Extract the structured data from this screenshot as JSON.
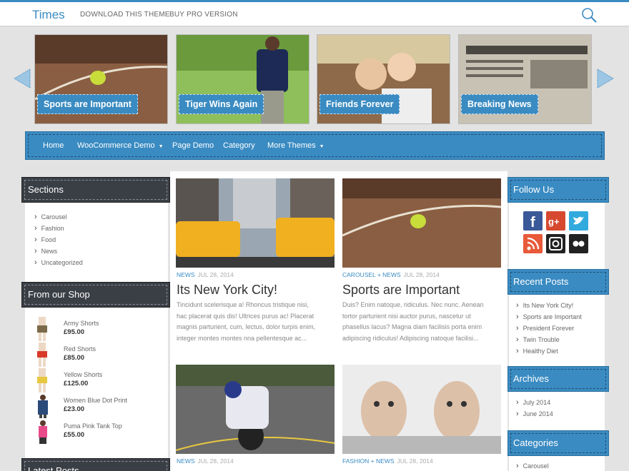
{
  "header": {
    "site_title": "Times",
    "links": [
      "DOWNLOAD THIS THEME",
      "BUY PRO VERSION"
    ]
  },
  "carousel": {
    "slides": [
      {
        "caption": "Sports are Important"
      },
      {
        "caption": "Tiger Wins Again"
      },
      {
        "caption": "Friends Forever"
      },
      {
        "caption": "Breaking News"
      }
    ]
  },
  "nav": {
    "items": [
      "Home",
      "WooCommerce Demo",
      "Page Demo",
      "Category",
      "More Themes"
    ]
  },
  "sections": {
    "title": "Sections",
    "items": [
      "Carousel",
      "Fashion",
      "Food",
      "News",
      "Uncategorized"
    ]
  },
  "shop": {
    "title": "From our Shop",
    "items": [
      {
        "name": "Army Shorts",
        "price": "£95.00"
      },
      {
        "name": "Red Shorts",
        "price": "£85.00"
      },
      {
        "name": "Yellow Shorts",
        "price": "£125.00"
      },
      {
        "name": "Women Blue Dot Print",
        "price": "£23.00"
      },
      {
        "name": "Puma Pink Tank Top",
        "price": "£55.00"
      }
    ]
  },
  "latest": {
    "title": "Latest Posts"
  },
  "posts": [
    {
      "category": "NEWS",
      "date": "JUL 28, 2014",
      "title": "Its New York City!",
      "excerpt": [
        "Tincidunt scelerisque a! Rhoncus tristique nisi,",
        "hac placerat quis dis! Ultrices purus ac! Placerat",
        "magnis parturient, cum, lectus, dolor turpis enim,",
        "integer montes montes nna pellentesque ac..."
      ]
    },
    {
      "category": "CAROUSEL",
      "category2": "NEWS",
      "date": "JUL 28, 2014",
      "title": "Sports are Important",
      "excerpt": [
        "Duis? Enim natoque, ridiculus. Nec nunc. Aenean",
        "tortor parturient nisi auctor purus, nascetur ut",
        "phasellus lacus? Magna diam facilisis porta enim",
        "adipiscing ridiculus! Adipiscing natoque facilisi..."
      ]
    },
    {
      "category": "NEWS",
      "date": "JUL 28, 2014"
    },
    {
      "category": "FASHION",
      "category2": "NEWS",
      "date": "JUL 28, 2014"
    }
  ],
  "follow": {
    "title": "Follow Us",
    "icons": [
      "facebook-icon",
      "google-plus-icon",
      "twitter-icon",
      "rss-icon",
      "instagram-icon",
      "flickr-icon"
    ]
  },
  "recent": {
    "title": "Recent Posts",
    "items": [
      "Its New York City!",
      "Sports are Important",
      "President Forever",
      "Twin Trouble",
      "Healthy Diet"
    ]
  },
  "archives": {
    "title": "Archives",
    "items": [
      "July 2014",
      "June 2014"
    ]
  },
  "categories": {
    "title": "Categories",
    "items": [
      "Carousel"
    ]
  },
  "colors": {
    "accent": "#3a8bc2",
    "dark": "#3a3f46"
  }
}
